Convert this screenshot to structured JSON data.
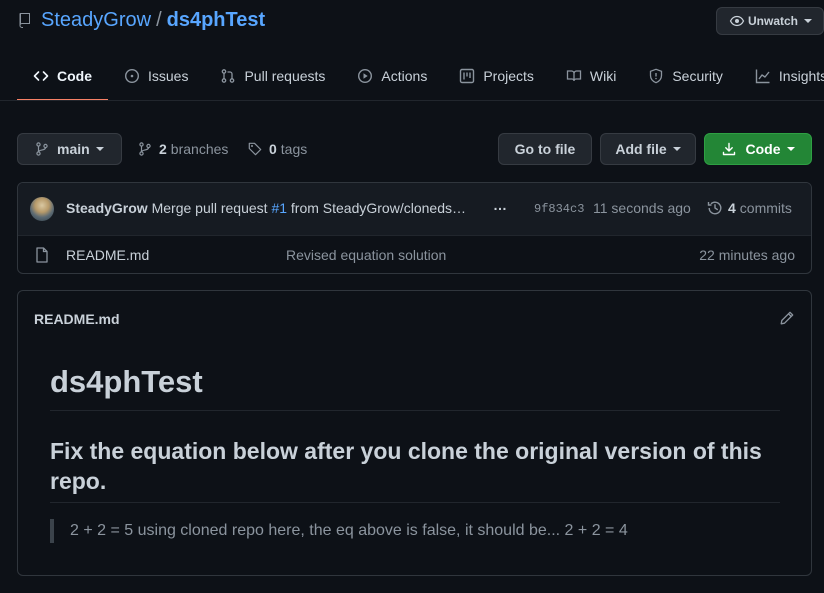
{
  "repo": {
    "owner": "SteadyGrow",
    "separator": "/",
    "name": "ds4phTest",
    "unwatch_label": "Unwatch"
  },
  "tabs": [
    {
      "label": "Code",
      "icon": "code-icon"
    },
    {
      "label": "Issues",
      "icon": "issue-icon"
    },
    {
      "label": "Pull requests",
      "icon": "pull-request-icon"
    },
    {
      "label": "Actions",
      "icon": "play-icon"
    },
    {
      "label": "Projects",
      "icon": "project-icon"
    },
    {
      "label": "Wiki",
      "icon": "book-icon"
    },
    {
      "label": "Security",
      "icon": "shield-icon"
    },
    {
      "label": "Insights",
      "icon": "graph-icon"
    }
  ],
  "branch_bar": {
    "branch": "main",
    "branches_count": "2",
    "branches_label": "branches",
    "tags_count": "0",
    "tags_label": "tags",
    "go_to_file": "Go to file",
    "add_file": "Add file",
    "code": "Code"
  },
  "commit": {
    "author": "SteadyGrow",
    "message_prefix": "Merge pull request",
    "pr_number": "#1",
    "message_suffix": "from SteadyGrow/cloneds…",
    "ellipsis": "…",
    "sha": "9f834c3",
    "time": "11 seconds ago",
    "commits_count": "4",
    "commits_label": "commits"
  },
  "files": [
    {
      "name": "README.md",
      "message": "Revised equation solution",
      "time": "22 minutes ago"
    }
  ],
  "readme": {
    "title": "README.md",
    "h1": "ds4phTest",
    "h2": "Fix the equation below after you clone the original version of this repo.",
    "quote": "2 + 2 = 5 using cloned repo here, the eq above is false, it should be... 2 + 2 = 4"
  },
  "colors": {
    "background": "#0d1117",
    "link": "#58a6ff",
    "code_button": "#238636",
    "active_tab_underline": "#f78166"
  }
}
